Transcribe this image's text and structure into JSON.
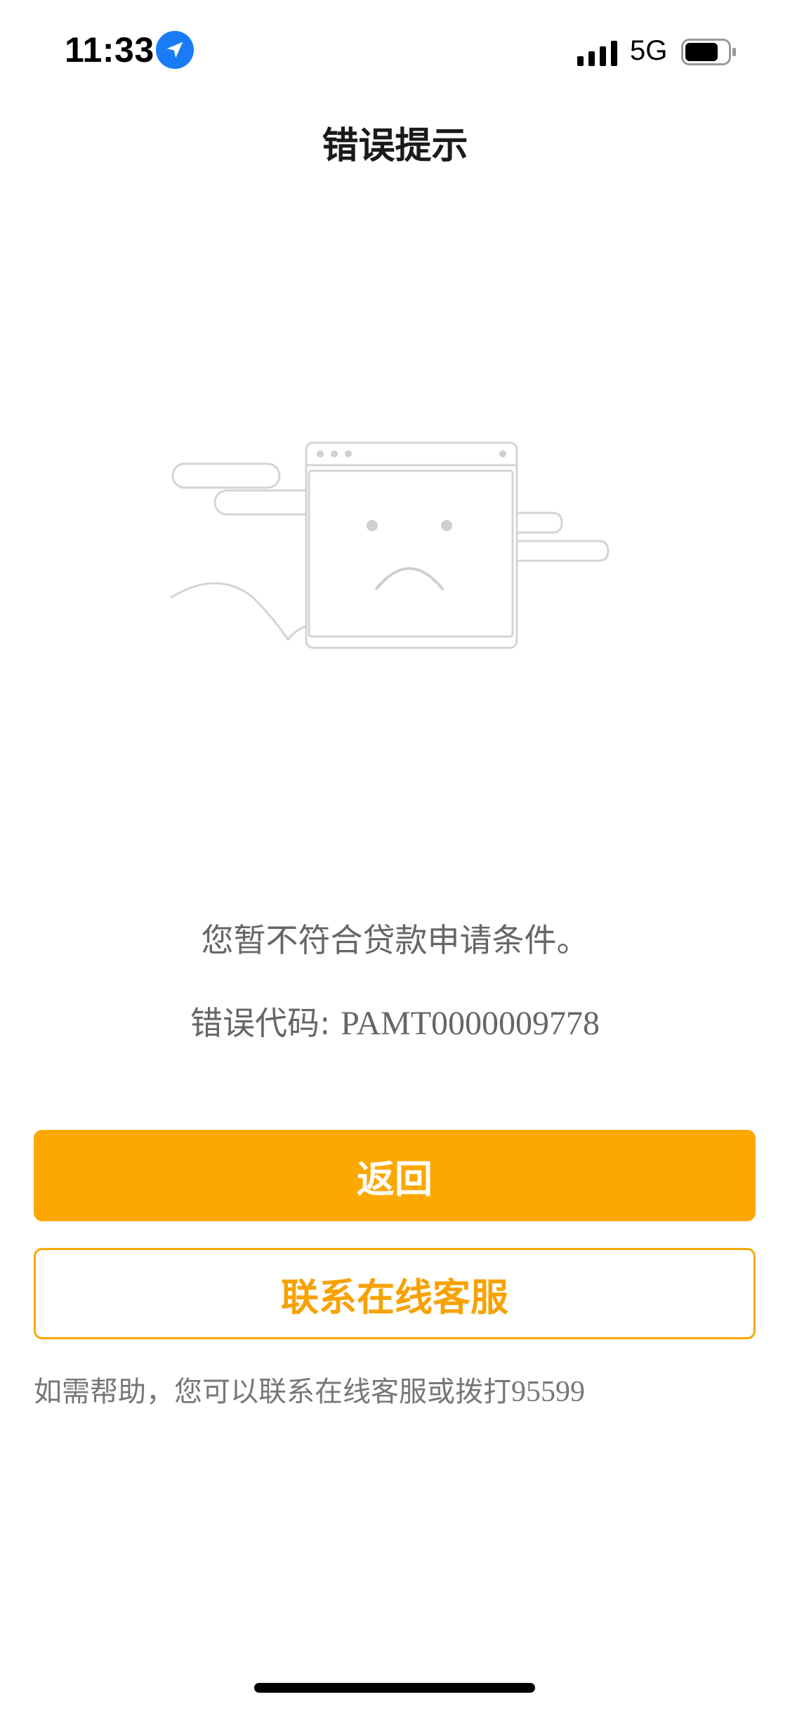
{
  "status_bar": {
    "time": "11:33",
    "network": "5G",
    "icons": [
      "location-arrow-icon",
      "signal-bars-icon",
      "battery-icon"
    ]
  },
  "nav": {
    "title": "错误提示"
  },
  "illustration": {
    "icon": "sad-browser-window-icon"
  },
  "message": {
    "main": "您暂不符合贷款申请条件。",
    "code_label": "错误代码: ",
    "code_value": "PAMT0000009778"
  },
  "buttons": {
    "back": "返回",
    "contact": "联系在线客服"
  },
  "help": {
    "text": "如需帮助，您可以联系在线客服或拨打",
    "phone": "95599"
  },
  "colors": {
    "accent": "#fda701",
    "outline": "#f7a700",
    "text_secondary": "#666666",
    "location_badge": "#1a7cf5"
  }
}
